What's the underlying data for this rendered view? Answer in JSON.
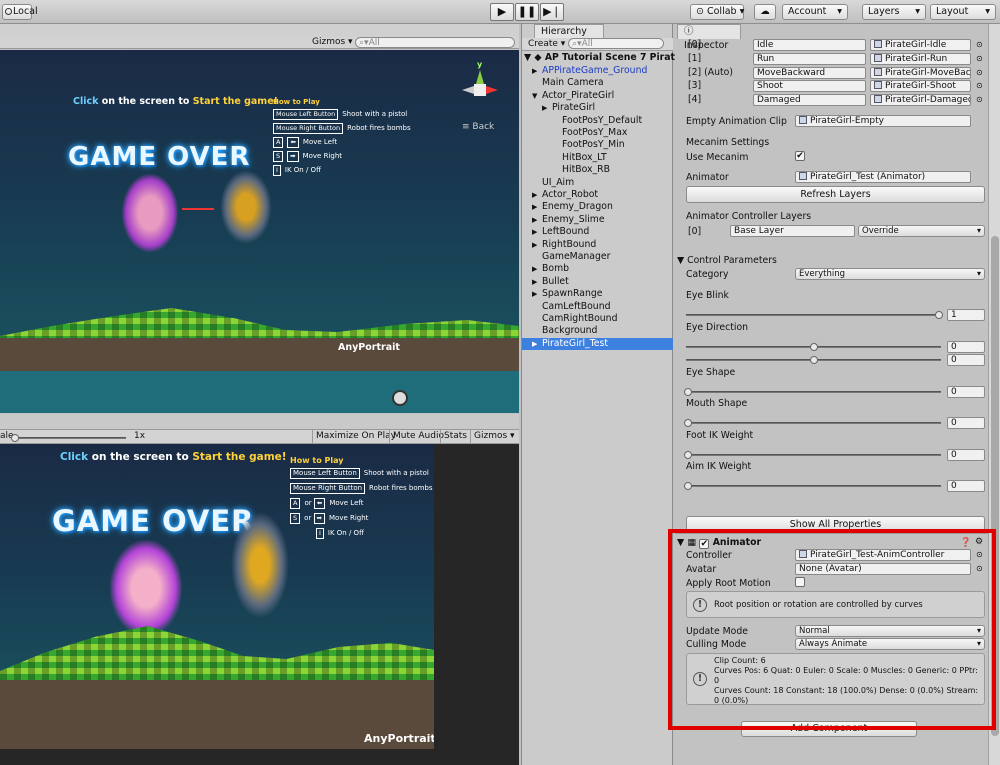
{
  "toolbar": {
    "local": "Local",
    "collab": "Collab",
    "cloud_icon": "cloud-icon",
    "account": "Account",
    "layers": "Layers",
    "layout": "Layout"
  },
  "scene_view": {
    "gizmos": "Gizmos",
    "search_placeholder": "All",
    "back": "Back"
  },
  "game_top": {
    "click": "Click",
    "on_the_screen": " on the screen to ",
    "start": "Start the game!",
    "game_over": "GAME OVER",
    "how_to_play": "How to Play",
    "controls": [
      {
        "key": "Mouse Left Button",
        "desc": "Shoot with a pistol"
      },
      {
        "key": "Mouse Right Button",
        "desc": "Robot fires bombs"
      }
    ],
    "keys": [
      {
        "k1": "A",
        "k2": "⬅",
        "desc": "Move Left"
      },
      {
        "k1": "S",
        "k2": "➡",
        "desc": "Move Right"
      },
      {
        "k1": "I",
        "desc": "IK On / Off"
      }
    ],
    "logo": "AnyPortrait"
  },
  "game_toolbar": {
    "scale": "ale",
    "scale_value": "1x",
    "maximize": "Maximize On Play",
    "mute": "Mute Audio",
    "stats": "Stats",
    "gizmos": "Gizmos"
  },
  "game_bottom": {
    "click": "Click",
    "on_the_screen": " on the screen to ",
    "start": "Start the game!",
    "game_over": "GAME OVER",
    "how_to_play": "How to Play",
    "controls": [
      {
        "key": "Mouse Left Button",
        "desc": "Shoot with a pistol"
      },
      {
        "key": "Mouse Right Button",
        "desc": "Robot fires bombs"
      }
    ],
    "keys": [
      {
        "k1": "A",
        "or": "or",
        "k2": "⬅",
        "desc": "Move Left"
      },
      {
        "k1": "S",
        "or": "or",
        "k2": "➡",
        "desc": "Move Right"
      },
      {
        "k1": "I",
        "desc": "IK On / Off"
      }
    ],
    "logo": "AnyPortrait"
  },
  "hierarchy": {
    "tab": "Hierarchy",
    "create": "Create",
    "search_placeholder": "All",
    "scene": "AP Tutorial Scene 7 Pirat",
    "items": [
      {
        "label": "APPirateGame_Ground",
        "indent": 1,
        "arrow": "▶",
        "color": "#1a3cc8"
      },
      {
        "label": "Main Camera",
        "indent": 1,
        "arrow": ""
      },
      {
        "label": "Actor_PirateGirl",
        "indent": 1,
        "arrow": "▼"
      },
      {
        "label": "PirateGirl",
        "indent": 2,
        "arrow": "▶"
      },
      {
        "label": "FootPosY_Default",
        "indent": 3,
        "arrow": ""
      },
      {
        "label": "FootPosY_Max",
        "indent": 3,
        "arrow": ""
      },
      {
        "label": "FootPosY_Min",
        "indent": 3,
        "arrow": ""
      },
      {
        "label": "HitBox_LT",
        "indent": 3,
        "arrow": ""
      },
      {
        "label": "HitBox_RB",
        "indent": 3,
        "arrow": ""
      },
      {
        "label": "UI_Aim",
        "indent": 1,
        "arrow": ""
      },
      {
        "label": "Actor_Robot",
        "indent": 1,
        "arrow": "▶"
      },
      {
        "label": "Enemy_Dragon",
        "indent": 1,
        "arrow": "▶"
      },
      {
        "label": "Enemy_Slime",
        "indent": 1,
        "arrow": "▶"
      },
      {
        "label": "LeftBound",
        "indent": 1,
        "arrow": "▶"
      },
      {
        "label": "RightBound",
        "indent": 1,
        "arrow": "▶"
      },
      {
        "label": "GameManager",
        "indent": 1,
        "arrow": ""
      },
      {
        "label": "Bomb",
        "indent": 1,
        "arrow": "▶"
      },
      {
        "label": "Bullet",
        "indent": 1,
        "arrow": "▶"
      },
      {
        "label": "SpawnRange",
        "indent": 1,
        "arrow": "▶"
      },
      {
        "label": "CamLeftBound",
        "indent": 1,
        "arrow": ""
      },
      {
        "label": "CamRightBound",
        "indent": 1,
        "arrow": ""
      },
      {
        "label": "Background",
        "indent": 1,
        "arrow": ""
      },
      {
        "label": "PirateGirl_Test",
        "indent": 1,
        "arrow": "▶",
        "selected": true
      }
    ]
  },
  "inspector": {
    "tab": "Inspector",
    "clips": [
      {
        "idx": "[0]",
        "name": "Idle",
        "clip": "PirateGirl-Idle"
      },
      {
        "idx": "[1]",
        "name": "Run",
        "clip": "PirateGirl-Run"
      },
      {
        "idx": "[2] (Auto)",
        "name": "MoveBackward",
        "clip": "PirateGirl-MoveBack"
      },
      {
        "idx": "[3]",
        "name": "Shoot",
        "clip": "PirateGirl-Shoot"
      },
      {
        "idx": "[4]",
        "name": "Damaged",
        "clip": "PirateGirl-Damaged"
      }
    ],
    "empty_clip_label": "Empty Animation Clip",
    "empty_clip_value": "PirateGirl-Empty",
    "mecanim_settings": "Mecanim Settings",
    "use_mecanim": "Use Mecanim",
    "animator_label": "Animator",
    "animator_value": "PirateGirl_Test (Animator)",
    "refresh_layers": "Refresh Layers",
    "controller_layers": "Animator Controller Layers",
    "layer_idx": "[0]",
    "layer_name": "Base Layer",
    "layer_blend": "Override",
    "control_params": "Control Parameters",
    "category_label": "Category",
    "category_value": "Everything",
    "params": [
      {
        "name": "Eye Blink",
        "values": [
          "1"
        ],
        "levels": [
          1
        ]
      },
      {
        "name": "Eye Direction",
        "values": [
          "0",
          "0"
        ],
        "levels": [
          0.5,
          0.5
        ]
      },
      {
        "name": "Eye Shape",
        "values": [
          "0"
        ],
        "levels": [
          0
        ]
      },
      {
        "name": "Mouth Shape",
        "values": [
          "0"
        ],
        "levels": [
          0
        ]
      },
      {
        "name": "Foot IK Weight",
        "values": [
          "0"
        ],
        "levels": [
          0
        ]
      },
      {
        "name": "Aim IK Weight",
        "values": [
          "0"
        ],
        "levels": [
          0
        ]
      }
    ],
    "show_all": "Show All Properties",
    "animator_comp": {
      "title": "Animator",
      "controller_label": "Controller",
      "controller_value": "PirateGirl_Test-AnimController",
      "avatar_label": "Avatar",
      "avatar_value": "None (Avatar)",
      "root_motion_label": "Apply Root Motion",
      "root_info": "Root position or rotation are controlled by curves",
      "update_label": "Update Mode",
      "update_value": "Normal",
      "culling_label": "Culling Mode",
      "culling_value": "Always Animate",
      "stats": "Clip Count: 6\nCurves Pos: 6 Quat: 0 Euler: 0 Scale: 0 Muscles: 0 Generic: 0 PPtr: 0\nCurves Count: 18 Constant: 18 (100.0%) Dense: 0 (0.0%) Stream: 0 (0.0%)"
    },
    "add_component": "Add Component",
    "highlight_color": "#e00000"
  }
}
